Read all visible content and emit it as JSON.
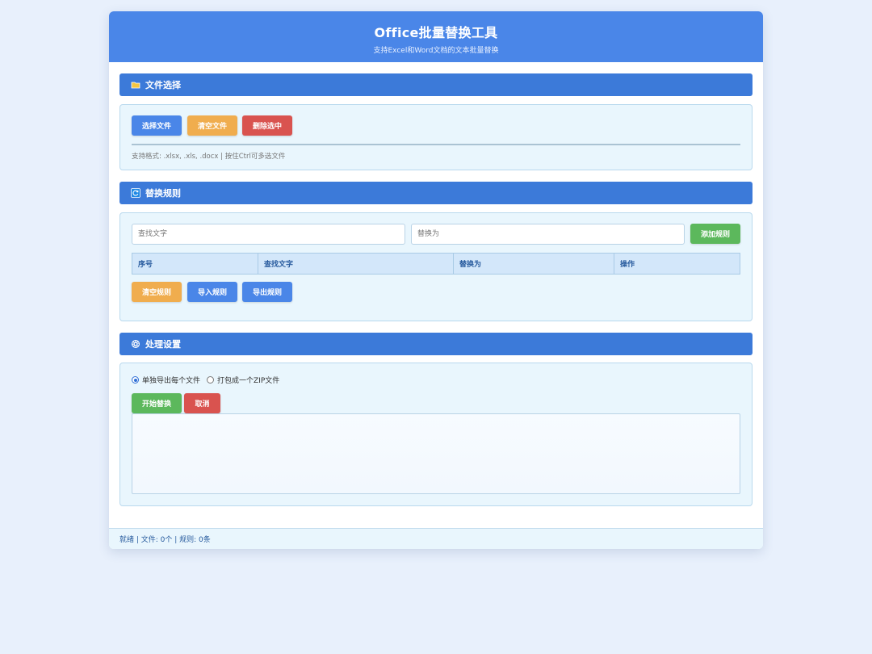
{
  "header": {
    "title": "Office批量替换工具",
    "subtitle": "支持Excel和Word文档的文本批量替换"
  },
  "file_section": {
    "title": "文件选择",
    "icon": "folder-icon",
    "buttons": {
      "select": "选择文件",
      "clear": "清空文件",
      "delete_selected": "删除选中"
    },
    "hint": "支持格式: .xlsx, .xls, .docx | 按住Ctrl可多选文件"
  },
  "rules_section": {
    "title": "替换规则",
    "icon": "refresh-icon",
    "find_placeholder": "查找文字",
    "replace_placeholder": "替换为",
    "add_button": "添加规则",
    "columns": [
      "序号",
      "查找文字",
      "替换为",
      "操作"
    ],
    "buttons": {
      "clear": "清空规则",
      "import": "导入规则",
      "export": "导出规则"
    }
  },
  "process_section": {
    "title": "处理设置",
    "icon": "gear-icon",
    "options": [
      {
        "label": "单独导出每个文件",
        "checked": true
      },
      {
        "label": "打包成一个ZIP文件",
        "checked": false
      }
    ],
    "start_button": "开始替换",
    "cancel_button": "取消"
  },
  "statusbar": {
    "text": "就绪 | 文件: 0个 | 规则: 0条"
  },
  "colors": {
    "header": "#4a86e8",
    "section_bar": "#3c7ad9",
    "panel": "#e9f6fd",
    "blue": "#4a86e8",
    "orange": "#f0ad4e",
    "red": "#d9534f",
    "green": "#5cb85c"
  }
}
